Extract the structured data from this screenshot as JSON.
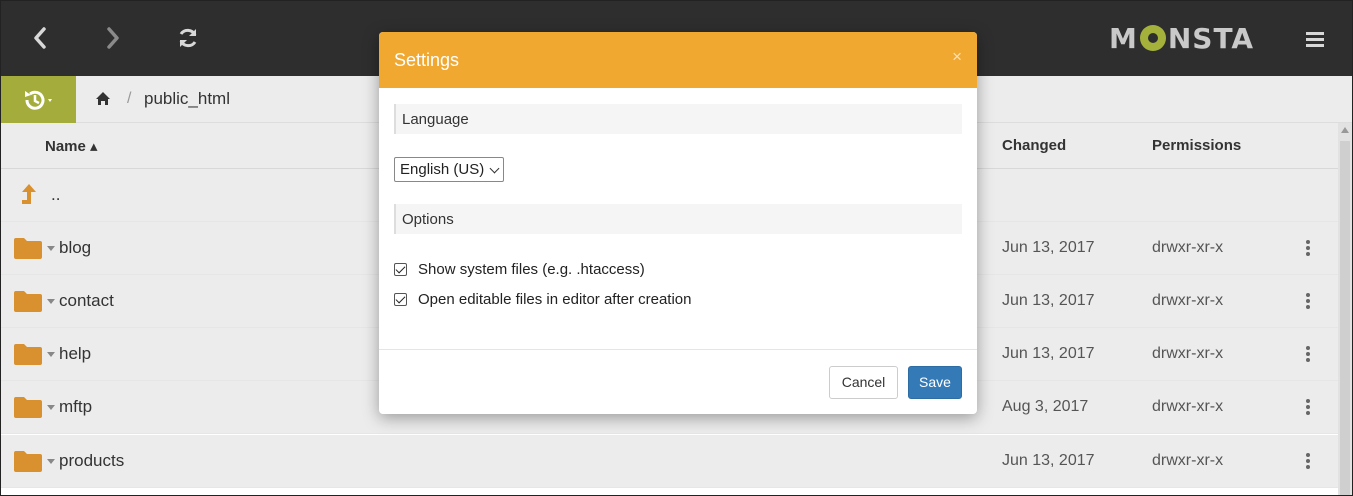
{
  "toolbar": {
    "back_icon": "chevron-left-icon",
    "forward_icon": "chevron-right-icon",
    "refresh_icon": "refresh-icon",
    "logo_text_left": "M",
    "logo_text_right": "NSTA",
    "menu_icon": "hamburger-menu-icon"
  },
  "breadcrumb": {
    "history_icon": "history-icon",
    "home_icon": "home-icon",
    "separator": "/",
    "path": "public_html"
  },
  "table": {
    "columns": {
      "name": "Name ▴",
      "changed": "Changed",
      "permissions": "Permissions"
    },
    "up_row": "..",
    "rows": [
      {
        "name": "blog",
        "changed": "Jun 13, 2017",
        "permissions": "drwxr-xr-x"
      },
      {
        "name": "contact",
        "changed": "Jun 13, 2017",
        "permissions": "drwxr-xr-x"
      },
      {
        "name": "help",
        "changed": "Jun 13, 2017",
        "permissions": "drwxr-xr-x"
      },
      {
        "name": "mftp",
        "changed": "Aug 3, 2017",
        "permissions": "drwxr-xr-x"
      },
      {
        "name": "products",
        "changed": "Jun 13, 2017",
        "permissions": "drwxr-xr-x"
      }
    ]
  },
  "modal": {
    "title": "Settings",
    "close": "×",
    "language_section": "Language",
    "language_value": "English (US)",
    "options_section": "Options",
    "option_1": "Show system files (e.g. .htaccess)",
    "option_1_checked": true,
    "option_2": "Open editable files in editor after creation",
    "option_2_checked": true,
    "cancel_label": "Cancel",
    "save_label": "Save"
  },
  "colors": {
    "header_orange": "#f0a830",
    "save_blue": "#337ab7",
    "history_green": "#a4ad3b",
    "folder": "#d9902f"
  }
}
